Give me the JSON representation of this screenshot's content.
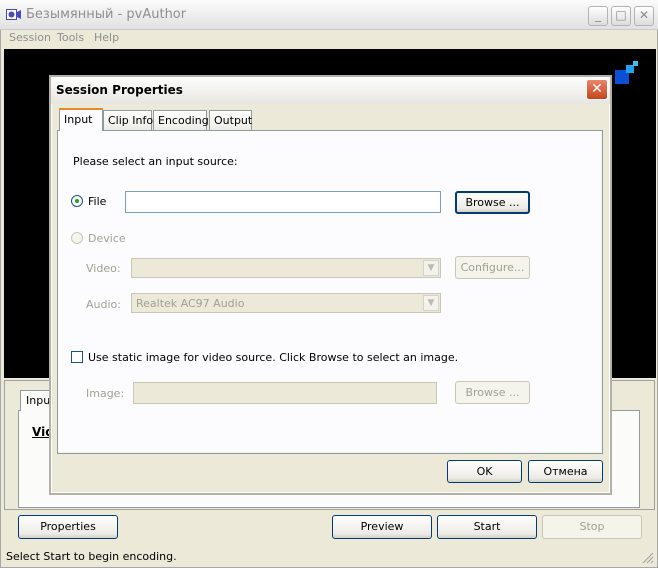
{
  "window": {
    "title": "Безымянный - pvAuthor",
    "minimize_glyph": "_",
    "maximize_glyph": "□",
    "close_glyph": "✕"
  },
  "menu": {
    "items": [
      "Session",
      "Tools",
      "Help"
    ]
  },
  "lower_panel": {
    "tab_label": "Input",
    "vid_text": "Vid",
    "buttons": {
      "properties": "Properties",
      "preview": "Preview",
      "start": "Start",
      "stop": "Stop"
    }
  },
  "status_bar": {
    "text": "Select Start to begin encoding."
  },
  "dialog": {
    "title": "Session Properties",
    "close_glyph": "✕",
    "tabs": [
      "Input",
      "Clip Info",
      "Encoding",
      "Output"
    ],
    "active_tab": "Input",
    "prompt": "Please select an input source:",
    "file_label": "File",
    "file_value": "",
    "browse_label": "Browse ...",
    "device_label": "Device",
    "video_label": "Video:",
    "video_value": "",
    "configure_label": "Configure...",
    "audio_label": "Audio:",
    "audio_value": "Realtek AC97 Audio",
    "static_image_label": "Use static image for video source. Click Browse to select an image.",
    "image_label": "Image:",
    "image_value": "",
    "image_browse_label": "Browse ...",
    "ok_label": "OK",
    "cancel_label": "Отмена",
    "combo_arrow": "▼"
  },
  "colors": {
    "title_accent": "#e68b2c",
    "close_button": "#c4451c",
    "radio_dot": "#21a121",
    "logo_blue": "#0a4fd6"
  },
  "icons": {
    "app": "camera-icon",
    "logo": "squares-logo-icon",
    "grip": "resize-grip-icon"
  }
}
